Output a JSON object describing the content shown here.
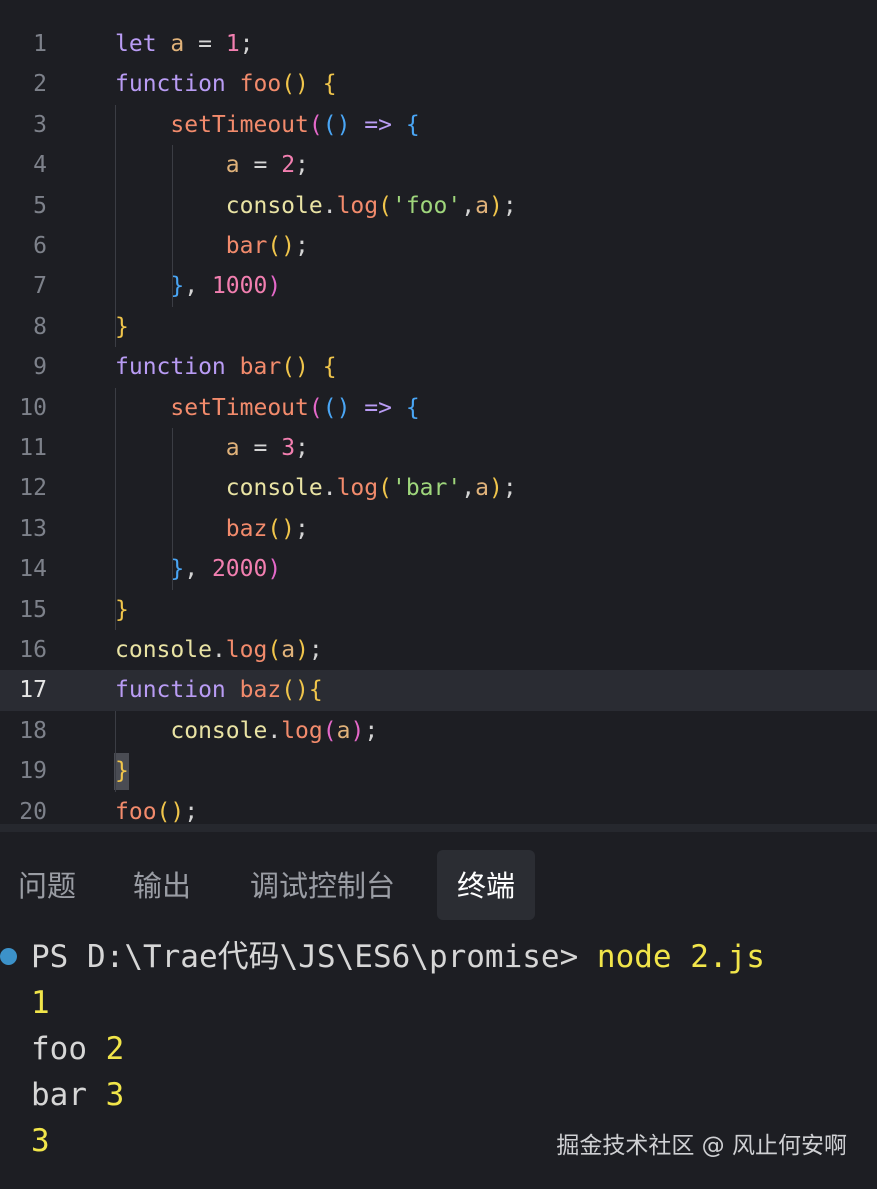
{
  "editor": {
    "current_line": 17,
    "line_numbers": [
      "1",
      "2",
      "3",
      "4",
      "5",
      "6",
      "7",
      "8",
      "9",
      "10",
      "11",
      "12",
      "13",
      "14",
      "15",
      "16",
      "17",
      "18",
      "19",
      "20"
    ],
    "lines": [
      [
        [
          "kw",
          "let"
        ],
        [
          "pu",
          " "
        ],
        [
          "var",
          "a"
        ],
        [
          "op",
          " = "
        ],
        [
          "num",
          "1"
        ],
        [
          "pu",
          ";"
        ]
      ],
      [
        [
          "kw",
          "function"
        ],
        [
          "pu",
          " "
        ],
        [
          "fn",
          "foo"
        ],
        [
          "b1",
          "()"
        ],
        [
          "pu",
          " "
        ],
        [
          "b1",
          "{"
        ]
      ],
      [
        [
          "pu",
          "    "
        ],
        [
          "fn",
          "setTimeout"
        ],
        [
          "b2",
          "("
        ],
        [
          "b3",
          "()"
        ],
        [
          "pu",
          " "
        ],
        [
          "ar",
          "=>"
        ],
        [
          "pu",
          " "
        ],
        [
          "b3",
          "{"
        ]
      ],
      [
        [
          "pu",
          "        "
        ],
        [
          "var",
          "a"
        ],
        [
          "op",
          " = "
        ],
        [
          "num",
          "2"
        ],
        [
          "pu",
          ";"
        ]
      ],
      [
        [
          "pu",
          "        "
        ],
        [
          "ob",
          "console"
        ],
        [
          "pu",
          "."
        ],
        [
          "fn",
          "log"
        ],
        [
          "b1",
          "("
        ],
        [
          "str",
          "'foo'"
        ],
        [
          "pu",
          ","
        ],
        [
          "var",
          "a"
        ],
        [
          "b1",
          ")"
        ],
        [
          "pu",
          ";"
        ]
      ],
      [
        [
          "pu",
          "        "
        ],
        [
          "fn",
          "bar"
        ],
        [
          "b1",
          "()"
        ],
        [
          "pu",
          ";"
        ]
      ],
      [
        [
          "pu",
          "    "
        ],
        [
          "b3",
          "}"
        ],
        [
          "pu",
          ", "
        ],
        [
          "num",
          "1000"
        ],
        [
          "b2",
          ")"
        ]
      ],
      [
        [
          "b1",
          "}"
        ]
      ],
      [
        [
          "kw",
          "function"
        ],
        [
          "pu",
          " "
        ],
        [
          "fn",
          "bar"
        ],
        [
          "b1",
          "()"
        ],
        [
          "pu",
          " "
        ],
        [
          "b1",
          "{"
        ]
      ],
      [
        [
          "pu",
          "    "
        ],
        [
          "fn",
          "setTimeout"
        ],
        [
          "b2",
          "("
        ],
        [
          "b3",
          "()"
        ],
        [
          "pu",
          " "
        ],
        [
          "ar",
          "=>"
        ],
        [
          "pu",
          " "
        ],
        [
          "b3",
          "{"
        ]
      ],
      [
        [
          "pu",
          "        "
        ],
        [
          "var",
          "a"
        ],
        [
          "op",
          " = "
        ],
        [
          "num",
          "3"
        ],
        [
          "pu",
          ";"
        ]
      ],
      [
        [
          "pu",
          "        "
        ],
        [
          "ob",
          "console"
        ],
        [
          "pu",
          "."
        ],
        [
          "fn",
          "log"
        ],
        [
          "b1",
          "("
        ],
        [
          "str",
          "'bar'"
        ],
        [
          "pu",
          ","
        ],
        [
          "var",
          "a"
        ],
        [
          "b1",
          ")"
        ],
        [
          "pu",
          ";"
        ]
      ],
      [
        [
          "pu",
          "        "
        ],
        [
          "fn",
          "baz"
        ],
        [
          "b1",
          "()"
        ],
        [
          "pu",
          ";"
        ]
      ],
      [
        [
          "pu",
          "    "
        ],
        [
          "b3",
          "}"
        ],
        [
          "pu",
          ", "
        ],
        [
          "num",
          "2000"
        ],
        [
          "b2",
          ")"
        ]
      ],
      [
        [
          "b1",
          "}"
        ]
      ],
      [
        [
          "ob",
          "console"
        ],
        [
          "pu",
          "."
        ],
        [
          "fn",
          "log"
        ],
        [
          "b1",
          "("
        ],
        [
          "var",
          "a"
        ],
        [
          "b1",
          ")"
        ],
        [
          "pu",
          ";"
        ]
      ],
      [
        [
          "kw",
          "function"
        ],
        [
          "pu",
          " "
        ],
        [
          "fn",
          "baz"
        ],
        [
          "b1",
          "()"
        ],
        [
          "b1",
          "{"
        ]
      ],
      [
        [
          "pu",
          "    "
        ],
        [
          "ob",
          "console"
        ],
        [
          "pu",
          "."
        ],
        [
          "fn",
          "log"
        ],
        [
          "b2",
          "("
        ],
        [
          "var",
          "a"
        ],
        [
          "b2",
          ")"
        ],
        [
          "pu",
          ";"
        ]
      ],
      [
        [
          "b1",
          "}"
        ]
      ],
      [
        [
          "fn",
          "foo"
        ],
        [
          "b1",
          "()"
        ],
        [
          "pu",
          ";"
        ]
      ]
    ]
  },
  "panel": {
    "tabs": [
      {
        "label": "问题",
        "active": false
      },
      {
        "label": "输出",
        "active": false
      },
      {
        "label": "调试控制台",
        "active": false
      },
      {
        "label": "终端",
        "active": true
      }
    ]
  },
  "terminal": {
    "prompt": "PS D:\\Trae代码\\JS\\ES6\\promise> ",
    "command": "node 2.js",
    "output": [
      [
        [
          "yel",
          "1"
        ]
      ],
      [
        [
          "pu",
          "foo "
        ],
        [
          "yel",
          "2"
        ]
      ],
      [
        [
          "pu",
          "bar "
        ],
        [
          "yel",
          "3"
        ]
      ],
      [
        [
          "yel",
          "3"
        ]
      ]
    ]
  },
  "watermark": "掘金技术社区 @ 风止何安啊",
  "colors": {
    "background": "#1d1e23",
    "current_line": "#2a2c33",
    "keyword": "#b99cf4",
    "function": "#f28b6c",
    "string": "#9fd67c",
    "number": "#f27fb0",
    "terminal_yellow": "#f1e54a",
    "terminal_dot": "#3c92c9"
  }
}
